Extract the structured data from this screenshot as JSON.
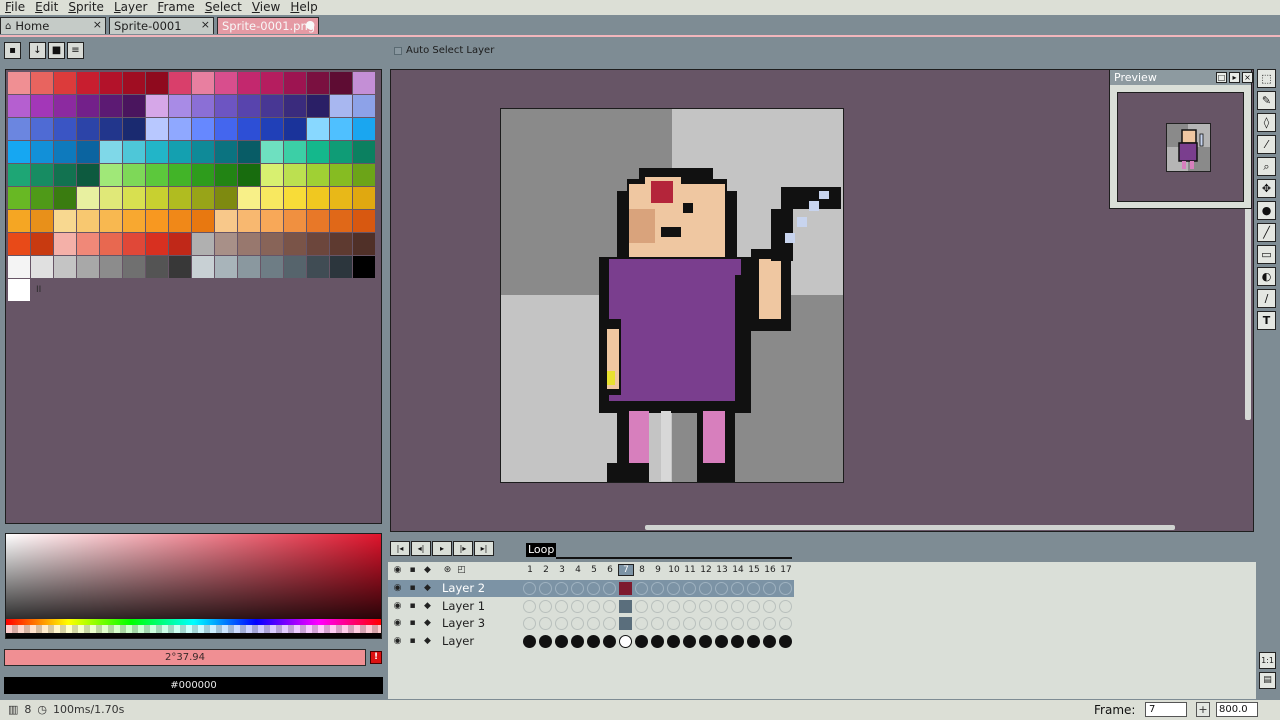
{
  "menu": [
    "File",
    "Edit",
    "Sprite",
    "Layer",
    "Frame",
    "Select",
    "View",
    "Help"
  ],
  "tabs": [
    {
      "label": "Home",
      "icon": "home-icon",
      "close": "×"
    },
    {
      "label": "Sprite-0001",
      "close": "×"
    },
    {
      "label": "Sprite-0001.png",
      "modified_marker": "●"
    }
  ],
  "toolbar": {
    "auto_select_label": "Auto Select Layer"
  },
  "palette": {
    "colors": [
      "#f08f93",
      "#e8645f",
      "#dc3b3b",
      "#c81e2f",
      "#b3122a",
      "#a00d22",
      "#8f0a1e",
      "#d93f6b",
      "#e87fa0",
      "#d84e8d",
      "#c3286e",
      "#b51d5f",
      "#9d1451",
      "#7a1040",
      "#5e0c33",
      "#c48fd6",
      "#b55fd0",
      "#a337b8",
      "#8c2aa0",
      "#73208a",
      "#5c1a73",
      "#4a155e",
      "#d6a7e8",
      "#a88be6",
      "#8b6fd6",
      "#6d55c2",
      "#5844ad",
      "#483794",
      "#3a2b7d",
      "#2a1f66",
      "#a8b7f0",
      "#8da2e8",
      "#6b86e0",
      "#4f6bd4",
      "#3a55c4",
      "#2c44a8",
      "#22368c",
      "#1a2a70",
      "#b8c8ff",
      "#8fa8ff",
      "#6688ff",
      "#4466ee",
      "#2d4fd6",
      "#2040b8",
      "#1a339a",
      "#88d8ff",
      "#4fc0ff",
      "#1aa6f0",
      "#16a7f2",
      "#1290d8",
      "#0e7abd",
      "#0b64a0",
      "#7fd8e8",
      "#4ec7d8",
      "#22b5c8",
      "#14a0b0",
      "#0f8a98",
      "#0b7380",
      "#085c66",
      "#6ee0c0",
      "#3ccfa6",
      "#14b88c",
      "#0f9c76",
      "#0b8060",
      "#1ea675",
      "#178c62",
      "#127250",
      "#0d5a3f",
      "#a0e878",
      "#7ed858",
      "#5cc83c",
      "#42b428",
      "#2e9c1c",
      "#228414",
      "#186c0e",
      "#d8f070",
      "#bce050",
      "#a0d034",
      "#86bc22",
      "#6ca418",
      "#68b824",
      "#4f9a18",
      "#3a7c10",
      "#e8f0a0",
      "#e0e878",
      "#d8e050",
      "#c8d030",
      "#b0bc20",
      "#98a418",
      "#7e8a10",
      "#f8f088",
      "#f8e860",
      "#f8dc38",
      "#f0c820",
      "#e8b818",
      "#e0a810",
      "#f5a623",
      "#e8901a",
      "#f8d890",
      "#f8c870",
      "#f8b850",
      "#f8a830",
      "#f89820",
      "#f08818",
      "#e87810",
      "#f8c88a",
      "#f8b870",
      "#f8a858",
      "#f09040",
      "#e87828",
      "#e06818",
      "#d85810",
      "#e84a18",
      "#c83a10",
      "#f4b0a8",
      "#f08878",
      "#e86850",
      "#e04838",
      "#d83020",
      "#c02818",
      "#b0b0b0",
      "#a89088",
      "#98786e",
      "#886458",
      "#7a5448",
      "#6c463c",
      "#5e3a30",
      "#503028",
      "#f4f4f4",
      "#e0e0e0",
      "#c4c4c4",
      "#a8a8a8",
      "#8c8c8c",
      "#707070",
      "#545454",
      "#383838",
      "#c8d0d4",
      "#a8b4ba",
      "#8a989f",
      "#6e7d85",
      "#56646c",
      "#404c54",
      "#2c363d",
      "#000000",
      "#ffffff"
    ],
    "marker": "II"
  },
  "color_picker": {
    "value_label": "2°37.94",
    "hex_label": "#000000",
    "warning": "!"
  },
  "preview": {
    "title": "Preview"
  },
  "timeline": {
    "loop_label": "Loop",
    "frames": [
      "1",
      "2",
      "3",
      "4",
      "5",
      "6",
      "7",
      "8",
      "9",
      "10",
      "11",
      "12",
      "13",
      "14",
      "15",
      "16",
      "17"
    ],
    "current_frame": 7,
    "layers": [
      {
        "name": "Layer 2",
        "selected": true
      },
      {
        "name": "Layer 1",
        "selected": false
      },
      {
        "name": "Layer 3",
        "selected": false
      },
      {
        "name": "Layer",
        "selected": false
      }
    ]
  },
  "status": {
    "frame_count": "8",
    "duration": "100ms/1.70s",
    "frame_label": "Frame:",
    "frame_value": "7",
    "zoom_value": "800.0"
  },
  "colors": {
    "accent": "#e59aa4",
    "canvas_bg": "#675566",
    "panel": "#7e8c94",
    "selection": "#7c93a5"
  }
}
